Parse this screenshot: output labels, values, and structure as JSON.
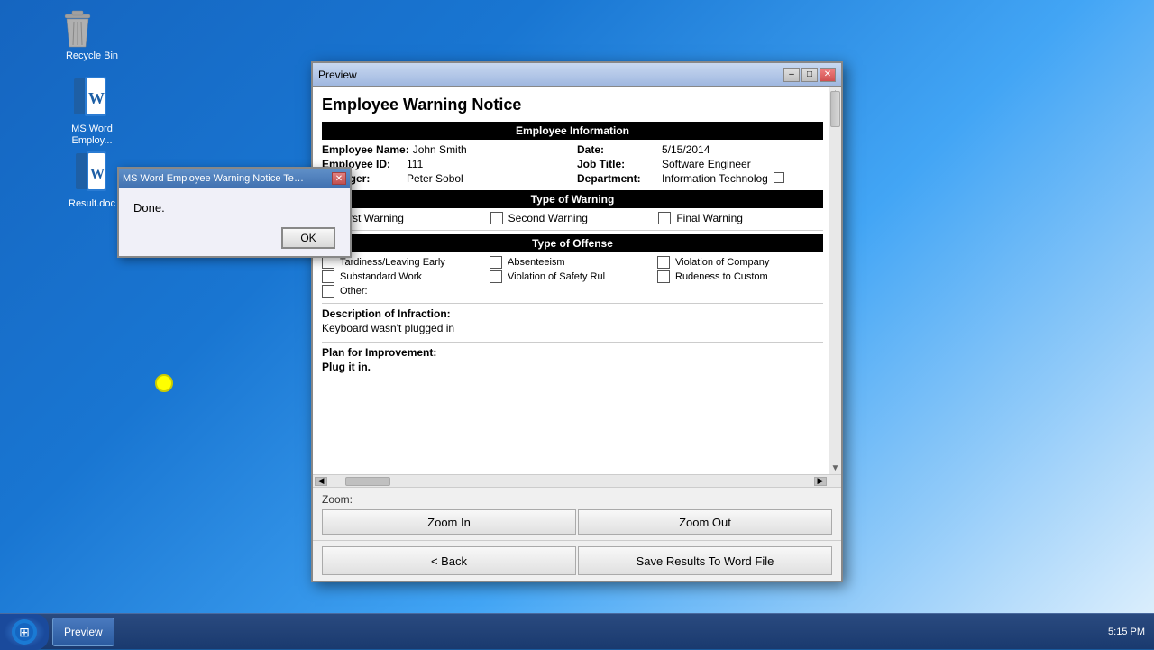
{
  "desktop": {
    "icons": [
      {
        "name": "Recycle Bin",
        "id": "recycle-bin"
      },
      {
        "name": "MS Word\nEmploy...",
        "id": "ms-word-employ"
      },
      {
        "name": "Result.doc",
        "id": "result-doc"
      }
    ]
  },
  "taskbar": {
    "preview_label": "Preview"
  },
  "window": {
    "title": "Preview",
    "controls": {
      "minimize": "–",
      "maximize": "□",
      "close": "✕"
    }
  },
  "form": {
    "title": "Employee Warning Notice",
    "employee_info_header": "Employee Information",
    "fields": {
      "employee_name_label": "Employee Name:",
      "employee_name_value": "John Smith",
      "date_label": "Date:",
      "date_value": "5/15/2014",
      "employee_id_label": "Employee ID:",
      "employee_id_value": "111",
      "job_title_label": "Job Title:",
      "job_title_value": "Software Engineer",
      "manager_label": "Manager:",
      "manager_value": "Peter Sobol",
      "department_label": "Department:",
      "department_value": "Information Technolog"
    },
    "warning_type_header": "Type of Warning",
    "warning_types": [
      {
        "label": "First Warning",
        "checked": false
      },
      {
        "label": "Second Warning",
        "checked": false
      },
      {
        "label": "Final Warning",
        "checked": false
      }
    ],
    "offense_header": "Type of Offense",
    "offenses": [
      {
        "label": "Tardiness/Leaving Early",
        "checked": false
      },
      {
        "label": "Absenteeism",
        "checked": false
      },
      {
        "label": "Violation of Company",
        "checked": false
      },
      {
        "label": "Substandard Work",
        "checked": false
      },
      {
        "label": "Violation of Safety Rul",
        "checked": false
      },
      {
        "label": "Rudeness to Custom",
        "checked": false
      },
      {
        "label": "Other:",
        "checked": false
      }
    ],
    "description_label": "Description of Infraction:",
    "description_text": "Keyboard wasn't plugged in",
    "plan_label": "Plan for Improvement:",
    "plan_text": "Plug it in."
  },
  "zoom": {
    "label": "Zoom:",
    "zoom_in": "Zoom In",
    "zoom_out": "Zoom Out"
  },
  "buttons": {
    "back": "< Back",
    "save": "Save Results To Word File"
  },
  "dialog": {
    "title": "MS Word Employee Warning Notice Tem....",
    "message": "Done.",
    "ok_button": "OK"
  }
}
